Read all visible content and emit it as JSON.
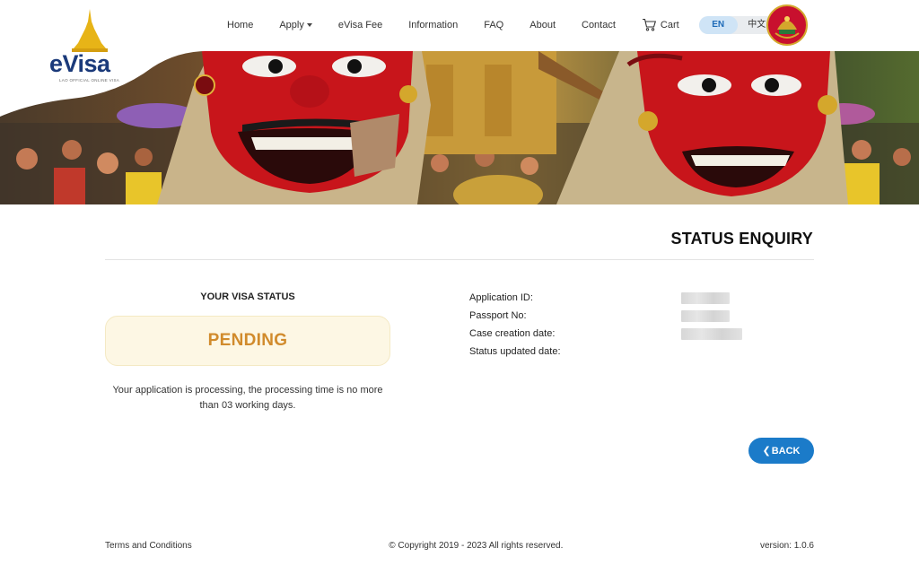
{
  "brand": {
    "logo_text": "eVisa",
    "logo_subtitle": "LAO OFFICIAL ONLINE VISA"
  },
  "nav": {
    "items": [
      {
        "label": "Home"
      },
      {
        "label": "Apply"
      },
      {
        "label": "eVisa Fee"
      },
      {
        "label": "Information"
      },
      {
        "label": "FAQ"
      },
      {
        "label": "About"
      },
      {
        "label": "Contact"
      }
    ],
    "cart_label": "Cart",
    "languages": [
      {
        "label": "EN",
        "active": true
      },
      {
        "label": "中文",
        "active": false
      }
    ]
  },
  "page": {
    "title": "STATUS ENQUIRY"
  },
  "visa_status": {
    "heading": "YOUR VISA STATUS",
    "value": "PENDING",
    "message": "Your application is processing, the processing time is no more than 03 working days."
  },
  "application_info": {
    "labels": [
      "Application ID:",
      "Passport No:",
      "Case creation date:",
      "Status updated date:"
    ]
  },
  "actions": {
    "back_label": "BACK"
  },
  "footer": {
    "terms": "Terms and Conditions",
    "copyright": "© Copyright 2019 - 2023 All rights reserved.",
    "version": "version: 1.0.6"
  },
  "colors": {
    "accent": "#1b7bc9",
    "pending": "#d18b2c",
    "pending_bg": "#fdf7e4",
    "brand_blue": "#1b3a7a"
  }
}
